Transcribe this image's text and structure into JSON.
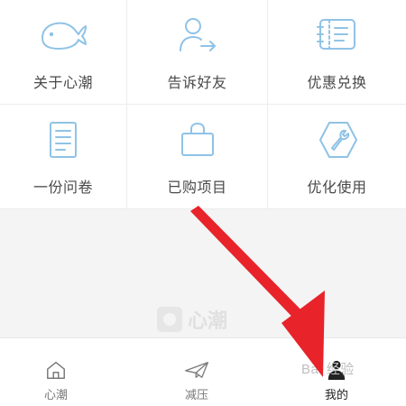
{
  "grid": [
    {
      "label": "关于心潮",
      "icon": "whale-icon"
    },
    {
      "label": "告诉好友",
      "icon": "share-user-icon"
    },
    {
      "label": "优惠兑换",
      "icon": "coupon-icon"
    },
    {
      "label": "一份问卷",
      "icon": "questionnaire-icon"
    },
    {
      "label": "已购项目",
      "icon": "shopping-bag-icon"
    },
    {
      "label": "优化使用",
      "icon": "wrench-icon"
    }
  ],
  "watermark_logo": "心潮",
  "tabs": [
    {
      "label": "心潮",
      "icon": "home-icon"
    },
    {
      "label": "减压",
      "icon": "paper-plane-icon"
    },
    {
      "label": "我的",
      "icon": "user-icon",
      "active": true
    }
  ],
  "watermark_right": "Bai 经验",
  "colors": {
    "icon_blue": "#8fc3e6",
    "arrow_red": "#e8232a"
  }
}
